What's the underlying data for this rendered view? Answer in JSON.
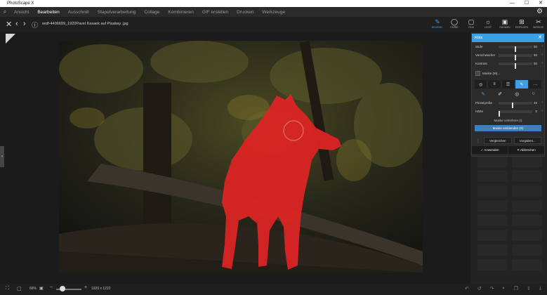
{
  "app": {
    "title": "PhotoScape X"
  },
  "window_controls": {
    "minimize": "—",
    "maximize": "☐",
    "close": "✕"
  },
  "menu": {
    "tabs": [
      "Ansicht",
      "Bearbeiten",
      "Ausschnitt",
      "Stapelverarbeitung",
      "Collage",
      "Kombinieren",
      "GIF erstellen",
      "Drucken",
      "Werkzeuge"
    ],
    "active_tab": "Bearbeiten"
  },
  "file": {
    "name": "wolf-4496699_1920Pavel Kasaek auf Pixabay .jpg"
  },
  "tools": [
    {
      "icon": "brush-icon",
      "glyph": "✎",
      "label": "BEARBEI.",
      "active": true
    },
    {
      "icon": "frame-icon",
      "glyph": "◯",
      "label": "FARBE",
      "active": false
    },
    {
      "icon": "film-icon",
      "glyph": "▢",
      "label": "FILM",
      "active": false
    },
    {
      "icon": "light-icon",
      "glyph": "☼",
      "label": "LICHT",
      "active": false
    },
    {
      "icon": "frame-square-icon",
      "glyph": "▣",
      "label": "RAHMEN",
      "active": false
    },
    {
      "icon": "insert-icon",
      "glyph": "⊞",
      "label": "EINFÜGEN",
      "active": false
    },
    {
      "icon": "tools-icon",
      "glyph": "✂",
      "label": "WERKZE.",
      "active": false
    }
  ],
  "dialog": {
    "title": "Rötx",
    "sliders": [
      {
        "name": "Stufe",
        "value": "50",
        "level": 0.5
      },
      {
        "name": "Verschwacher",
        "value": "50",
        "level": 0.5
      },
      {
        "name": "Kontrast",
        "value": "50",
        "level": 0.5
      }
    ],
    "mask_label": "Maske (M)...",
    "brush_size": {
      "name": "Pinselgröße",
      "value": "46",
      "level": 0.4
    },
    "hardness": {
      "name": "Härte",
      "value": "0",
      "level": 0.0
    },
    "invert_mask": "Maske umkehren (I)",
    "show_mask": "Maske einblenden (S)",
    "compare": "Vergleichen",
    "presets": "Vorgaben...",
    "apply": "Anwenden",
    "cancel": "Abbrechen"
  },
  "status": {
    "zoom": "66%",
    "dimensions": "1920 x 1222"
  },
  "colors": {
    "accent": "#3aa0e8",
    "mask": "#e02424"
  }
}
